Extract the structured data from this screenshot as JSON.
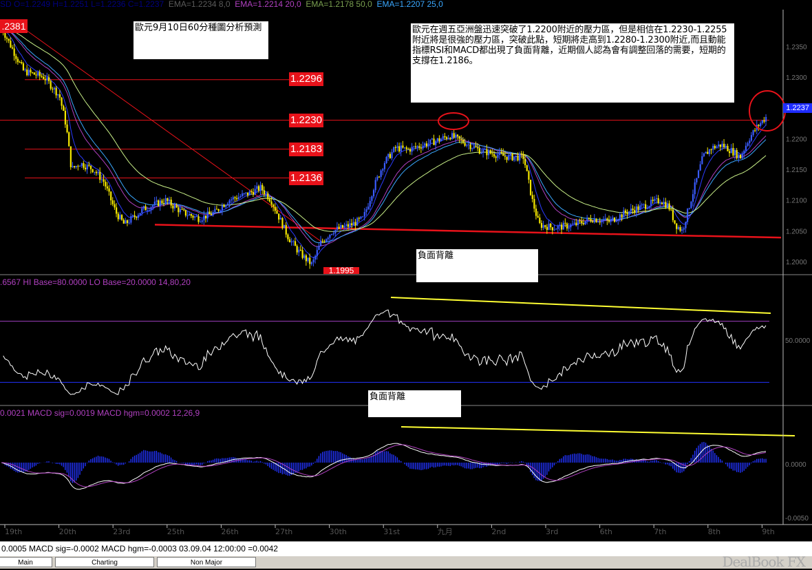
{
  "header": {
    "ohlc": "SD O=1.2249 H=1.2251 L=1.2236 C=1.2237",
    "ema1": "EMA=1.2234  8,0",
    "ema2": "EMA=1.2214  20,0",
    "ema3": "EMA=1.2178  50,0",
    "ema4": "EMA=1.2207  25,0",
    "rsi": ".6567  HI Base=80.0000  LO Base=20.0000   14,80,20",
    "macd": "0.0021  MACD sig=0.0019  MACD hgm=0.0002   12,26,9"
  },
  "colors": {
    "bg": "#000000",
    "candle": "#f5e800",
    "accent": "#e8121a",
    "ema1": "#2b3bff",
    "ema2": "#b040c0",
    "ema3": "#c9f088",
    "ema4": "#3aa8ff",
    "trend": "#ffff33",
    "osc": "#ffffff",
    "hist": "#2233ff"
  },
  "notes": {
    "title": "歐元9月10日60分種圖分析預測",
    "analysis": "歐元在週五亞洲盤迅速突破了1.2200附近的壓力區，但是相信在1.2230-1.2255附近將是很強的壓力區，突破此點，短期將走高到1.2280-1.2300附近,而且動能指標RSI和MACD都出現了負面背離，近期個人認為會有調整回落的需要，短期的支撐在1.2186。",
    "div1": "負面背離",
    "div2": "負面背離"
  },
  "levels": [
    "1.2296",
    "1.2230",
    "1.2183",
    "1.2136"
  ],
  "labels": {
    "left_price": ".2381",
    "low_price": "1.1995",
    "last_price": "1.2237"
  },
  "chart_data": {
    "type": "candlestick",
    "instrument": "EUR/USD 60 min",
    "y_ticks": [
      "1.2350",
      "1.2300",
      "1.2250",
      "1.2200",
      "1.2150",
      "1.2100",
      "1.2050",
      "1.2000"
    ],
    "ylim": [
      1.1982,
      1.241
    ],
    "x_ticks": [
      "19th",
      "20th",
      "23rd",
      "25th",
      "26th",
      "27th",
      "30th",
      "31st",
      "九月",
      "2nd",
      "3rd",
      "6th",
      "7th",
      "8th",
      "9th"
    ],
    "levels": [
      1.2296,
      1.223,
      1.2183,
      1.2136
    ],
    "close_path": [
      [
        0,
        1.2381
      ],
      [
        1.3,
        1.231
      ],
      [
        2.5,
        1.23
      ],
      [
        3.4,
        1.227
      ],
      [
        3.8,
        1.222
      ],
      [
        4.1,
        1.215
      ],
      [
        4.6,
        1.216
      ],
      [
        5.4,
        1.215
      ],
      [
        6,
        1.213
      ],
      [
        6.7,
        1.208
      ],
      [
        7.2,
        1.206
      ],
      [
        8.3,
        1.2085
      ],
      [
        9.6,
        1.21
      ],
      [
        10.6,
        1.208
      ],
      [
        11.6,
        1.207
      ],
      [
        12.5,
        1.208
      ],
      [
        13.3,
        1.21
      ],
      [
        14.4,
        1.211
      ],
      [
        15.2,
        1.212
      ],
      [
        15.8,
        1.21
      ],
      [
        16.3,
        1.207
      ],
      [
        16.8,
        1.204
      ],
      [
        17.3,
        1.202
      ],
      [
        17.8,
        1.2005
      ],
      [
        18.2,
        1.1995
      ],
      [
        18.7,
        1.203
      ],
      [
        19.4,
        1.205
      ],
      [
        20.5,
        1.206
      ],
      [
        21.2,
        1.207
      ],
      [
        21.8,
        1.212
      ],
      [
        22.4,
        1.216
      ],
      [
        23.1,
        1.2185
      ],
      [
        23.8,
        1.2182
      ],
      [
        25.3,
        1.2195
      ],
      [
        26.3,
        1.2205
      ],
      [
        27.4,
        1.219
      ],
      [
        28.1,
        1.218
      ],
      [
        29.7,
        1.217
      ],
      [
        30.6,
        1.217
      ],
      [
        31.1,
        1.21
      ],
      [
        31.5,
        1.206
      ],
      [
        32.4,
        1.2055
      ],
      [
        33.6,
        1.206
      ],
      [
        34.6,
        1.207
      ],
      [
        35.6,
        1.2065
      ],
      [
        36.6,
        1.208
      ],
      [
        37.6,
        1.209
      ],
      [
        38.6,
        1.21
      ],
      [
        39.1,
        1.209
      ],
      [
        39.5,
        1.206
      ],
      [
        39.9,
        1.205
      ],
      [
        40.2,
        1.208
      ],
      [
        40.6,
        1.212
      ],
      [
        41.1,
        1.217
      ],
      [
        41.6,
        1.2185
      ],
      [
        42.2,
        1.219
      ],
      [
        42.8,
        1.218
      ],
      [
        43.3,
        1.217
      ],
      [
        43.8,
        1.22
      ],
      [
        44.3,
        1.222
      ],
      [
        44.8,
        1.2235
      ]
    ],
    "markers": {
      "resistance_circle_price": 1.222,
      "top_right_circle_price": 1.223
    },
    "rsi": {
      "label": "RSI 14",
      "hi_base": 80,
      "lo_base": 20,
      "y_tick": "50.0000"
    },
    "macd": {
      "fast": 12,
      "slow": 26,
      "signal": 9,
      "y_ticks": [
        "0.0000",
        "-0.0050"
      ]
    }
  },
  "status": {
    "text": "0.0005  MACD sig=-0.0002  MACD hgm=-0.0003   03.09.04 12:00:00 =0.0042"
  },
  "tabs": [
    "Main",
    "Charting",
    "Non Major"
  ],
  "brand": "DealBook FX"
}
